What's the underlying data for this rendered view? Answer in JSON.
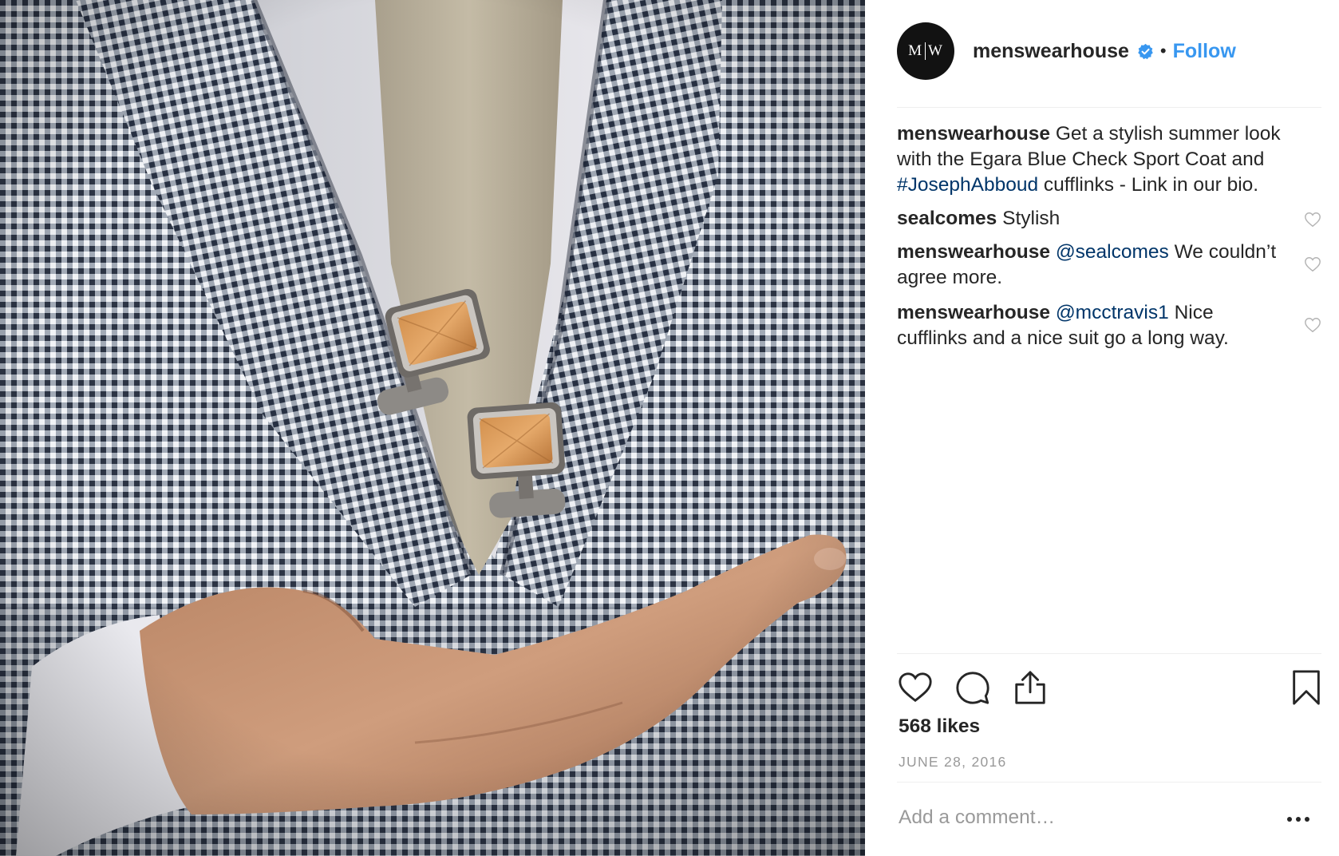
{
  "post": {
    "photo_description": "",
    "username": "menswearhouse",
    "avatar_text_left": "M",
    "avatar_text_right": "W",
    "verified": true,
    "separator_dot": "•",
    "follow_label": "Follow",
    "likes": "568 likes",
    "date": "JUNE 28, 2016",
    "add_comment_placeholder": "Add a comment…"
  },
  "comments": [
    {
      "user": "menswearhouse",
      "text_before": "Get a stylish summer look with the Egara Blue Check Sport Coat and ",
      "link": "#JosephAbboud",
      "text_after": " cufflinks - Link in our bio.",
      "has_heart": false
    },
    {
      "user": "sealcomes",
      "text_before": "Stylish",
      "link": "",
      "text_after": "",
      "has_heart": true
    },
    {
      "user": "menswearhouse",
      "text_before": "",
      "link": "@sealcomes",
      "text_after": " We couldn’t agree more.",
      "has_heart": true
    },
    {
      "user": "menswearhouse",
      "text_before": "",
      "link": "@mcctravis1",
      "text_after": " Nice cufflinks and a nice suit go a long way.",
      "has_heart": true
    }
  ],
  "icons": {
    "like": "heart-icon",
    "comment": "comment-bubble-icon",
    "share": "share-icon",
    "save": "bookmark-icon",
    "more": "more-options-icon",
    "verified": "verified-badge-icon",
    "comment_like": "heart-outline-icon"
  },
  "colors": {
    "accent": "#3897f0",
    "text": "#262626",
    "muted": "#999999",
    "link": "#003569",
    "divider": "#efefef",
    "avatar_bg": "#121212"
  }
}
